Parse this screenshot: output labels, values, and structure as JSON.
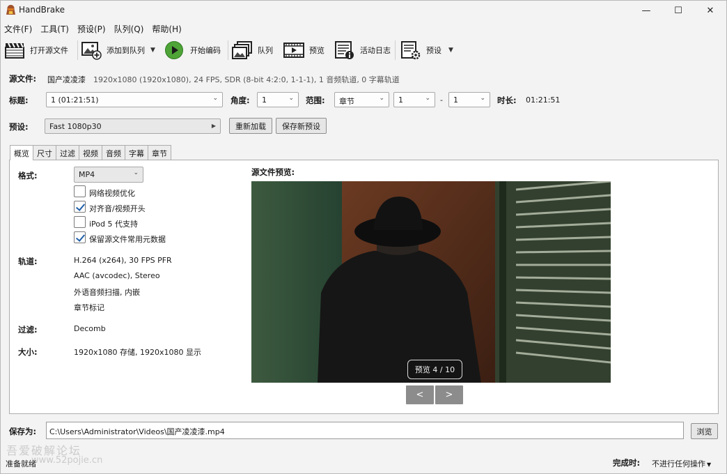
{
  "window": {
    "title": "HandBrake",
    "minimize": "—",
    "maximize": "☐",
    "close": "✕"
  },
  "menu": [
    "文件(F)",
    "工具(T)",
    "预设(P)",
    "队列(Q)",
    "帮助(H)"
  ],
  "toolbar": {
    "open_source": "打开源文件",
    "add_to_queue": "添加到队列",
    "start_encode": "开始编码",
    "queue": "队列",
    "preview": "预览",
    "activity_log": "活动日志",
    "presets": "预设"
  },
  "source": {
    "label": "源文件:",
    "name": "国产凌凌漆",
    "info": "1920x1080 (1920x1080), 24 FPS, SDR (8-bit 4:2:0, 1-1-1), 1 音频轨道, 0 字幕轨道"
  },
  "title_row": {
    "title_label": "标题:",
    "title_value": "1  (01:21:51)",
    "angle_label": "角度:",
    "angle_value": "1",
    "range_label": "范围:",
    "range_type": "章节",
    "range_start": "1",
    "range_dash": "-",
    "range_end": "1",
    "duration_label": "时长:",
    "duration_value": "01:21:51"
  },
  "preset_row": {
    "label": "预设:",
    "value": "Fast 1080p30",
    "reload": "重新加载",
    "save_new": "保存新预设"
  },
  "tabs": [
    "概览",
    "尺寸",
    "过滤",
    "视频",
    "音频",
    "字幕",
    "章节"
  ],
  "summary": {
    "format_label": "格式:",
    "format_value": "MP4",
    "options": [
      {
        "label": "网络视频优化",
        "checked": false
      },
      {
        "label": "对齐音/视频开头",
        "checked": true
      },
      {
        "label": "iPod 5 代支持",
        "checked": false
      },
      {
        "label": "保留源文件常用元数据",
        "checked": true
      }
    ],
    "tracks_label": "轨道:",
    "tracks": [
      "H.264 (x264), 30 FPS PFR",
      "AAC (avcodec), Stereo",
      "外语音频扫描, 内嵌",
      "章节标记"
    ],
    "filters_label": "过滤:",
    "filters_value": "Decomb",
    "size_label": "大小:",
    "size_value": "1920x1080 存储, 1920x1080 显示",
    "preview_label": "源文件预览:",
    "preview_counter": "预览 4 / 10",
    "prev": "<",
    "next": ">"
  },
  "destination": {
    "label": "保存为:",
    "path": "C:\\Users\\Administrator\\Videos\\国产凌凌漆.mp4",
    "browse": "浏览"
  },
  "status": {
    "left": "准备就绪",
    "when_done_label": "完成时:",
    "when_done_value": "不进行任何操作"
  },
  "watermark": {
    "line1": "吾爱破解论坛",
    "line2": "www.52pojie.cn"
  }
}
